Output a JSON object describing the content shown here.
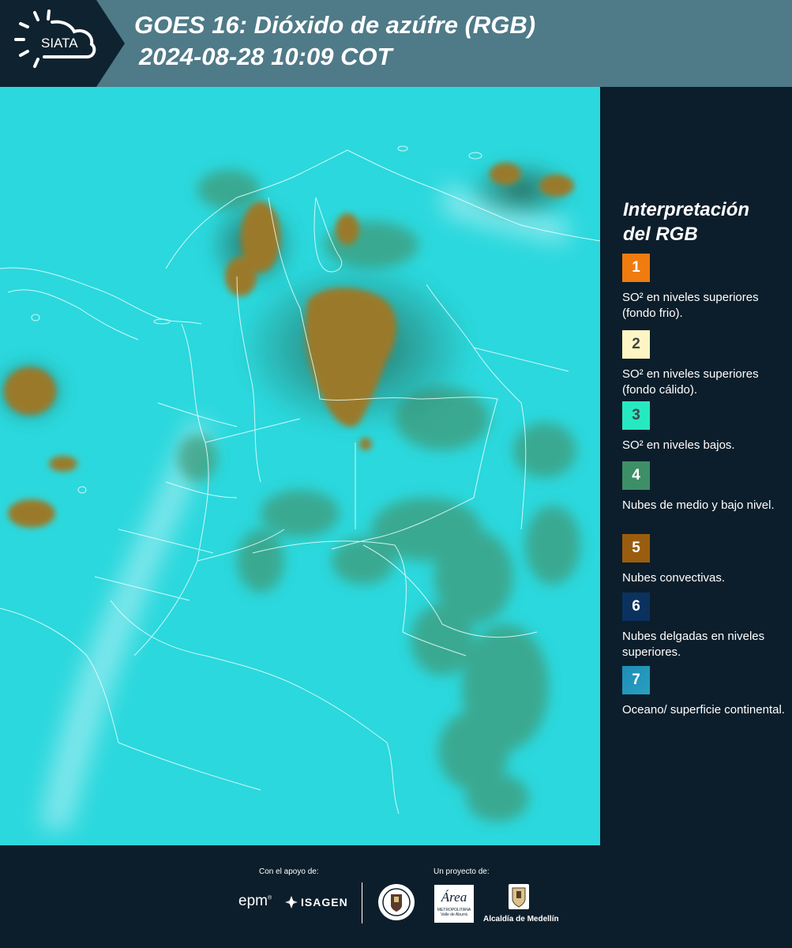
{
  "header": {
    "logo_text": "SIATA",
    "title": "GOES 16: Dióxido de azúfre (RGB)",
    "datetime": "2024-08-28 10:09 COT"
  },
  "legend": {
    "title_line1": "Interpretación",
    "title_line2": "del RGB",
    "items": [
      {
        "number": "1",
        "label": "SO² en niveles superiores (fondo frio).",
        "color": "#f07b0f",
        "text_color": "#ffffff"
      },
      {
        "number": "2",
        "label": "SO² en niveles superiores (fondo cálido).",
        "color": "#fdf6c4",
        "text_color": "#444444"
      },
      {
        "number": "3",
        "label": "SO² en niveles bajos.",
        "color": "#26e9c2",
        "text_color": "#3a4a4a"
      },
      {
        "number": "4",
        "label": "Nubes de medio y bajo nivel.",
        "color": "#3d8f68",
        "text_color": "#ffffff"
      },
      {
        "number": "5",
        "label": "Nubes convectivas.",
        "color": "#9a5d0f",
        "text_color": "#ffffff"
      },
      {
        "number": "6",
        "label": "Nubes delgadas en niveles superiores.",
        "color": "#0b315f",
        "text_color": "#ffffff"
      },
      {
        "number": "7",
        "label": "Oceano/ superficie continental.",
        "color": "#1d8db7",
        "text_color": "#ffffff"
      }
    ]
  },
  "footer": {
    "support_label": "Con el apoyo de:",
    "project_label": "Un proyecto de:",
    "sponsor_epm": "epm",
    "sponsor_isagen": "ISAGEN",
    "area_logo_text": "Área",
    "area_logo_caption": "METROPOLITANA Valle de Aburrá",
    "alcaldia_label": "Alcaldía de Medellín"
  },
  "colors": {
    "header_bg": "#4f7a88",
    "panel_bg": "#0c1e2b",
    "map_base": "#2fdde0",
    "convective": "#9a7a2c",
    "mid_low_clouds": "#3f9a78"
  }
}
